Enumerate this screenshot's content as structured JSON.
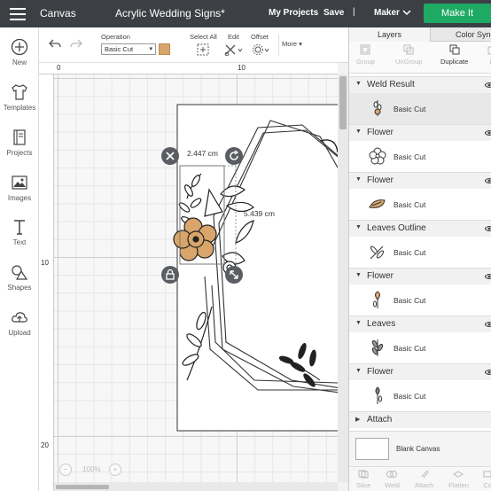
{
  "header": {
    "app_title": "Canvas",
    "doc_title": "Acrylic Wedding Signs*",
    "my_projects": "My Projects",
    "save": "Save",
    "separator": "|",
    "machine": "Maker",
    "make_it": "Make It"
  },
  "sidebar": {
    "items": [
      {
        "label": "New",
        "icon": "plus-circle-icon"
      },
      {
        "label": "Templates",
        "icon": "shirt-icon"
      },
      {
        "label": "Projects",
        "icon": "book-icon"
      },
      {
        "label": "Images",
        "icon": "image-icon"
      },
      {
        "label": "Text",
        "icon": "text-icon"
      },
      {
        "label": "Shapes",
        "icon": "shapes-icon"
      },
      {
        "label": "Upload",
        "icon": "cloud-upload-icon"
      }
    ]
  },
  "toolbar": {
    "operation_label": "Operation",
    "operation_value": "Basic Cut",
    "operation_color": "#d9a56a",
    "select_all": "Select All",
    "edit": "Edit",
    "offset": "Offset",
    "more": "More"
  },
  "ruler": {
    "top": [
      "0",
      "10"
    ],
    "left": [
      "10",
      "20"
    ]
  },
  "canvas": {
    "width_dim": "2.447 cm",
    "height_dim": "5.439 cm",
    "zoom": "100%"
  },
  "panel": {
    "tab_layers": "Layers",
    "tab_color": "Color Sync",
    "actions": [
      "Group",
      "UnGroup",
      "Duplicate",
      "D"
    ],
    "groups": [
      {
        "name": "Weld Result",
        "item": "Basic Cut",
        "selected": true
      },
      {
        "name": "Flower",
        "item": "Basic Cut"
      },
      {
        "name": "Flower",
        "item": "Basic Cut"
      },
      {
        "name": "Leaves Outline",
        "item": "Basic Cut"
      },
      {
        "name": "Flower",
        "item": "Basic Cut"
      },
      {
        "name": "Leaves",
        "item": "Basic Cut"
      },
      {
        "name": "Flower",
        "item": "Basic Cut"
      },
      {
        "name": "Attach",
        "item": ""
      }
    ],
    "blank_canvas": "Blank Canvas",
    "bottom_actions": [
      "Slice",
      "Weld",
      "Attach",
      "Flatten",
      "Co"
    ]
  }
}
